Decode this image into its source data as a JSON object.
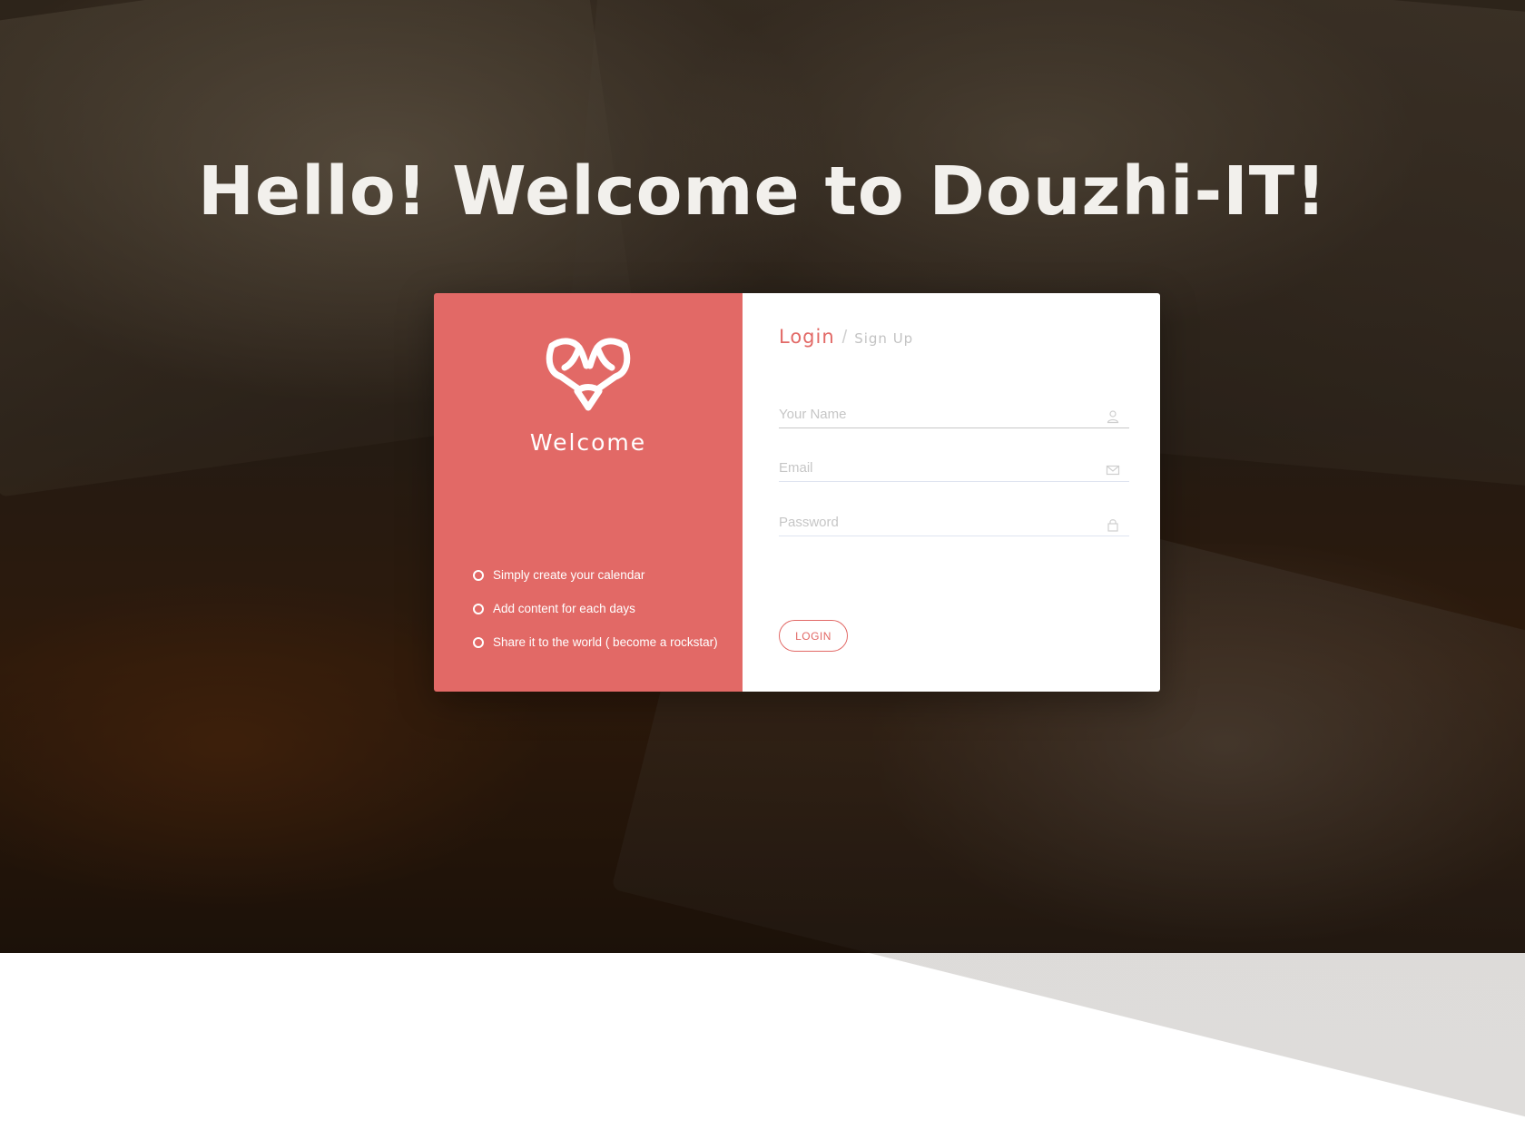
{
  "headline": "Hello! Welcome to Douzhi-IT!",
  "left_panel": {
    "welcome": "Welcome",
    "features": [
      "Simply create your calendar",
      "Add content for each days",
      "Share it to the world ( become a rockstar)"
    ]
  },
  "right_panel": {
    "tab_login": "Login",
    "tab_separator": "/",
    "tab_signup": "Sign Up",
    "fields": {
      "name_placeholder": "Your Name",
      "email_placeholder": "Email",
      "password_placeholder": "Password"
    },
    "login_button": "LOGIN"
  },
  "colors": {
    "accent": "#e26966",
    "panel_right": "#ffffff",
    "headline": "#f2f0ec"
  },
  "icons": {
    "logo": "deer-head-logo",
    "name": "user-icon",
    "email": "envelope-icon",
    "password": "lock-icon",
    "bullet": "circle-outline-icon"
  }
}
